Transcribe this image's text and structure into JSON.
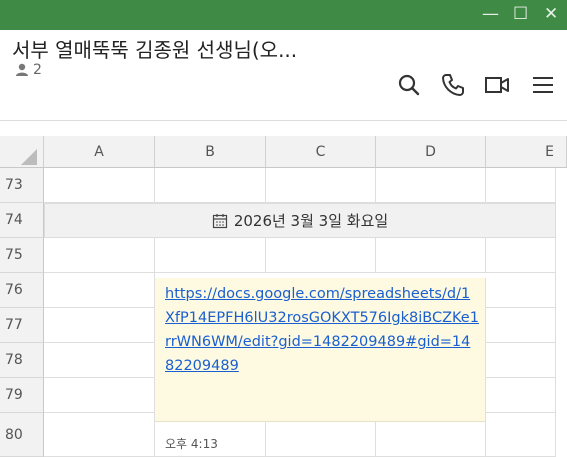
{
  "window": {
    "minimize": "—",
    "maximize": "☐",
    "close": "✕"
  },
  "chat": {
    "title": "서부 열매뚝뚝 김종원 선생님(오...",
    "member_count": "2"
  },
  "header_icons": [
    "search-icon",
    "call-icon",
    "video-call-icon",
    "menu-icon"
  ],
  "sheet": {
    "columns": [
      "A",
      "B",
      "C",
      "D",
      "E"
    ],
    "rows": [
      "73",
      "74",
      "75",
      "76",
      "77",
      "78",
      "79",
      "80"
    ],
    "date_separator": "2026년 3월 3일 화요일",
    "link": "https://docs.google.com/spreadsheets/d/1XfP14EPFH6lU32rosGOKXT576Igk8iBCZKe1rrWN6WM/edit?gid=1482209489#gid=1482209489",
    "timestamp": "오후 4:13"
  },
  "colors": {
    "titlebar": "#3f8a45",
    "link": "#1a5fd0",
    "message_bg": "#fdfae1"
  }
}
